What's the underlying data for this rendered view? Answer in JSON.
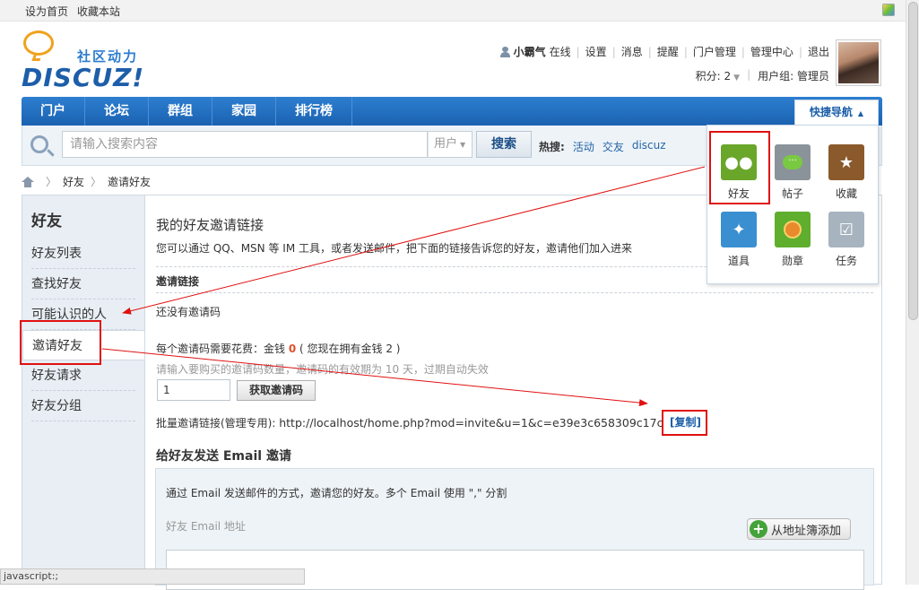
{
  "topbar": {
    "set_home": "设为首页",
    "bookmark": "收藏本站"
  },
  "logo": {
    "tagline": "社区动力",
    "word": "DISCUZ!"
  },
  "user": {
    "name": "小霸气",
    "status": "在线",
    "links": [
      "设置",
      "消息",
      "提醒",
      "门户管理",
      "管理中心",
      "退出"
    ],
    "points": "积分: 2",
    "group": "用户组: 管理员"
  },
  "nav": {
    "items": [
      "门户",
      "论坛",
      "群组",
      "家园",
      "排行榜"
    ],
    "quick": "快捷导航"
  },
  "search": {
    "placeholder": "请输入搜索内容",
    "scope": "用户",
    "button": "搜索",
    "hot_label": "热搜:",
    "hot": [
      "活动",
      "交友",
      "discuz"
    ]
  },
  "breadcrumb": [
    "好友",
    "邀请好友"
  ],
  "sidebar": {
    "title": "好友",
    "items": [
      "好友列表",
      "查找好友",
      "可能认识的人",
      "邀请好友",
      "好友请求",
      "好友分组"
    ],
    "active_index": 3
  },
  "main": {
    "title": "我的好友邀请链接",
    "desc": "您可以通过 QQ、MSN 等 IM 工具，或者发送邮件，把下面的链接告诉您的好友，邀请他们加入进来",
    "invite_link_label": "邀请链接",
    "no_code": "还没有邀请码",
    "cost_prefix": "每个邀请码需要花费：金钱 ",
    "cost_value": "0",
    "cost_suffix": " ( 您现在拥有金钱 2 )",
    "hint": "请输入要购买的邀请码数量，邀请码的有效期为 10 天，过期自动失效",
    "qty": "1",
    "get_button": "获取邀请码",
    "batch_label": "批量邀请链接(管理专用): ",
    "batch_url": "http://localhost/home.php?mod=invite&u=1&c=e39e3c658309c17c",
    "copy": "[复制]",
    "email_title": "给好友发送 Email 邀请",
    "email_desc": "通过 Email 发送邮件的方式，邀请您的好友。多个 Email 使用 \",\" 分割",
    "email_field_label": "好友 Email 地址",
    "add_from_book": "从地址簿添加"
  },
  "quicknav": {
    "items": [
      {
        "label": "好友",
        "icon": "friends-icon",
        "color": "#6aa62a"
      },
      {
        "label": "帖子",
        "icon": "post-bubble-icon",
        "color": "#8a9399"
      },
      {
        "label": "收藏",
        "icon": "star-icon",
        "color": "#8a5a2c"
      },
      {
        "label": "道具",
        "icon": "magic-wand-icon",
        "color": "#3a8fd0"
      },
      {
        "label": "勋章",
        "icon": "medal-icon",
        "color": "#5fae2e"
      },
      {
        "label": "任务",
        "icon": "task-check-icon",
        "color": "#a7b3bf"
      }
    ]
  },
  "statusbar": "javascript:;"
}
